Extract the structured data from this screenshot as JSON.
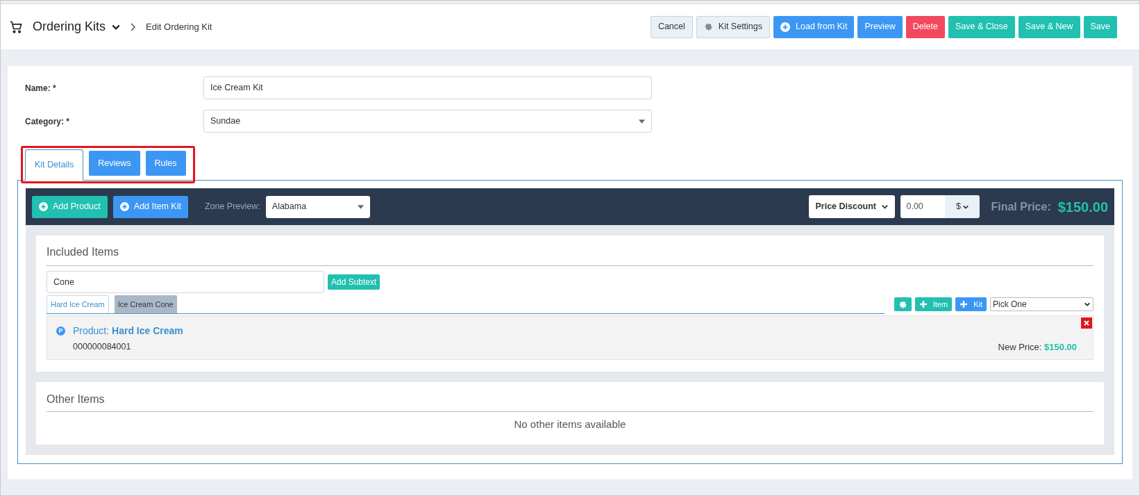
{
  "header": {
    "title": "Ordering Kits",
    "breadcrumb": "Edit Ordering Kit",
    "buttons": [
      {
        "label": "Cancel",
        "kind": "light"
      },
      {
        "label": "Kit Settings",
        "kind": "settings"
      },
      {
        "label": "Load from Kit",
        "kind": "load"
      },
      {
        "label": "Preview",
        "kind": "primary"
      },
      {
        "label": "Delete",
        "kind": "danger"
      },
      {
        "label": "Save & Close",
        "kind": "success"
      },
      {
        "label": "Save & New",
        "kind": "success"
      },
      {
        "label": "Save",
        "kind": "success"
      }
    ]
  },
  "form": {
    "name": {
      "label": "Name: *",
      "value": "Ice Cream Kit"
    },
    "category": {
      "label": "Category: *",
      "value": "Sundae"
    }
  },
  "tabs": [
    {
      "label": "Kit Details",
      "selected": true
    },
    {
      "label": "Reviews",
      "selected": false
    },
    {
      "label": "Rules",
      "selected": false
    }
  ],
  "toolbar": {
    "buttons": [
      {
        "label": "Add Product",
        "kind": "success"
      },
      {
        "label": "Add Item Kit",
        "kind": "primary"
      }
    ],
    "zone_label": "Zone Preview:",
    "zone_value": "Alabama",
    "discount_type": "Price Discount",
    "amount": "0.00",
    "unit": "$",
    "final_label": "Final Price:",
    "final_value": "$150.00"
  },
  "included": {
    "title": "Included Items",
    "subtext": "Cone",
    "add_subtext": "Add Subtext",
    "item_tabs": [
      {
        "label": "Hard Ice Cream",
        "selected": true
      },
      {
        "label": "Ice Cream Cone",
        "selected": false
      }
    ],
    "item_button": "Item",
    "kit_button": "Kit",
    "pick": "Pick One",
    "product": {
      "badge": "P",
      "prefix": "Product:",
      "name": "Hard Ice Cream",
      "code": "000000084001",
      "price_label": "New Price:",
      "price": "$150.00"
    }
  },
  "other": {
    "title": "Other Items",
    "empty": "No other items available"
  }
}
